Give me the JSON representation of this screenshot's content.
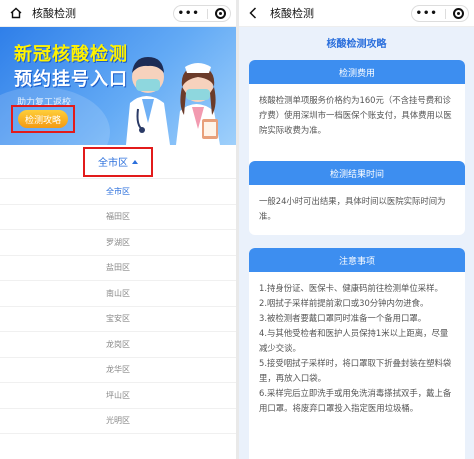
{
  "left": {
    "titlebar": {
      "title": "核酸检测"
    },
    "banner": {
      "line1": "新冠核酸检测",
      "line2": "预约挂号入口",
      "subtitle": "助力复工返校",
      "guide_button": "检测攻略"
    },
    "district_selector": {
      "label": "全市区"
    },
    "districts": [
      "全市区",
      "福田区",
      "罗湖区",
      "盐田区",
      "南山区",
      "宝安区",
      "龙岗区",
      "龙华区",
      "坪山区",
      "光明区"
    ],
    "selected_district": "全市区"
  },
  "right": {
    "titlebar": {
      "title": "核酸检测"
    },
    "page_title": "核酸检测攻略",
    "sections": [
      {
        "heading": "检测费用",
        "text": "核酸检测单项服务价格约为160元（不含挂号费和诊疗费）使用深圳市一档医保个账支付，具体费用以医院实际收费为准。"
      },
      {
        "heading": "检测结果时间",
        "text": "一般24小时可出结果，具体时间以医院实际时间为准。"
      },
      {
        "heading": "注意事项",
        "items": [
          "1.持身份证、医保卡、健康码前往检测单位采样。",
          "2.咽拭子采样前提前漱口或30分钟内勿进食。",
          "3.被检测者要戴口罩同时准备一个备用口罩。",
          "4.与其他受检者和医护人员保持1米以上距离，尽量减少交谈。",
          "5.接受咽拭子采样时，将口罩取下折叠封装在塑料袋里，再放入口袋。",
          "6.采样完后立即洗手或用免洗消毒搽拭双手，戴上备用口罩。将废弃口罩投入指定医用垃圾桶。"
        ]
      }
    ]
  },
  "icons": {
    "home": "home-icon",
    "back": "back-arrow-icon",
    "more": "more-dots-icon",
    "close": "target-close-icon",
    "caret": "caret-up-icon"
  },
  "colors": {
    "primary": "#3d8ef0",
    "accent_text": "#2b6fdc",
    "highlight": "#e21b1b",
    "banner_yellow": "#fff200",
    "button_orange": "#f39a12",
    "page_bg": "#eaf1fb"
  }
}
